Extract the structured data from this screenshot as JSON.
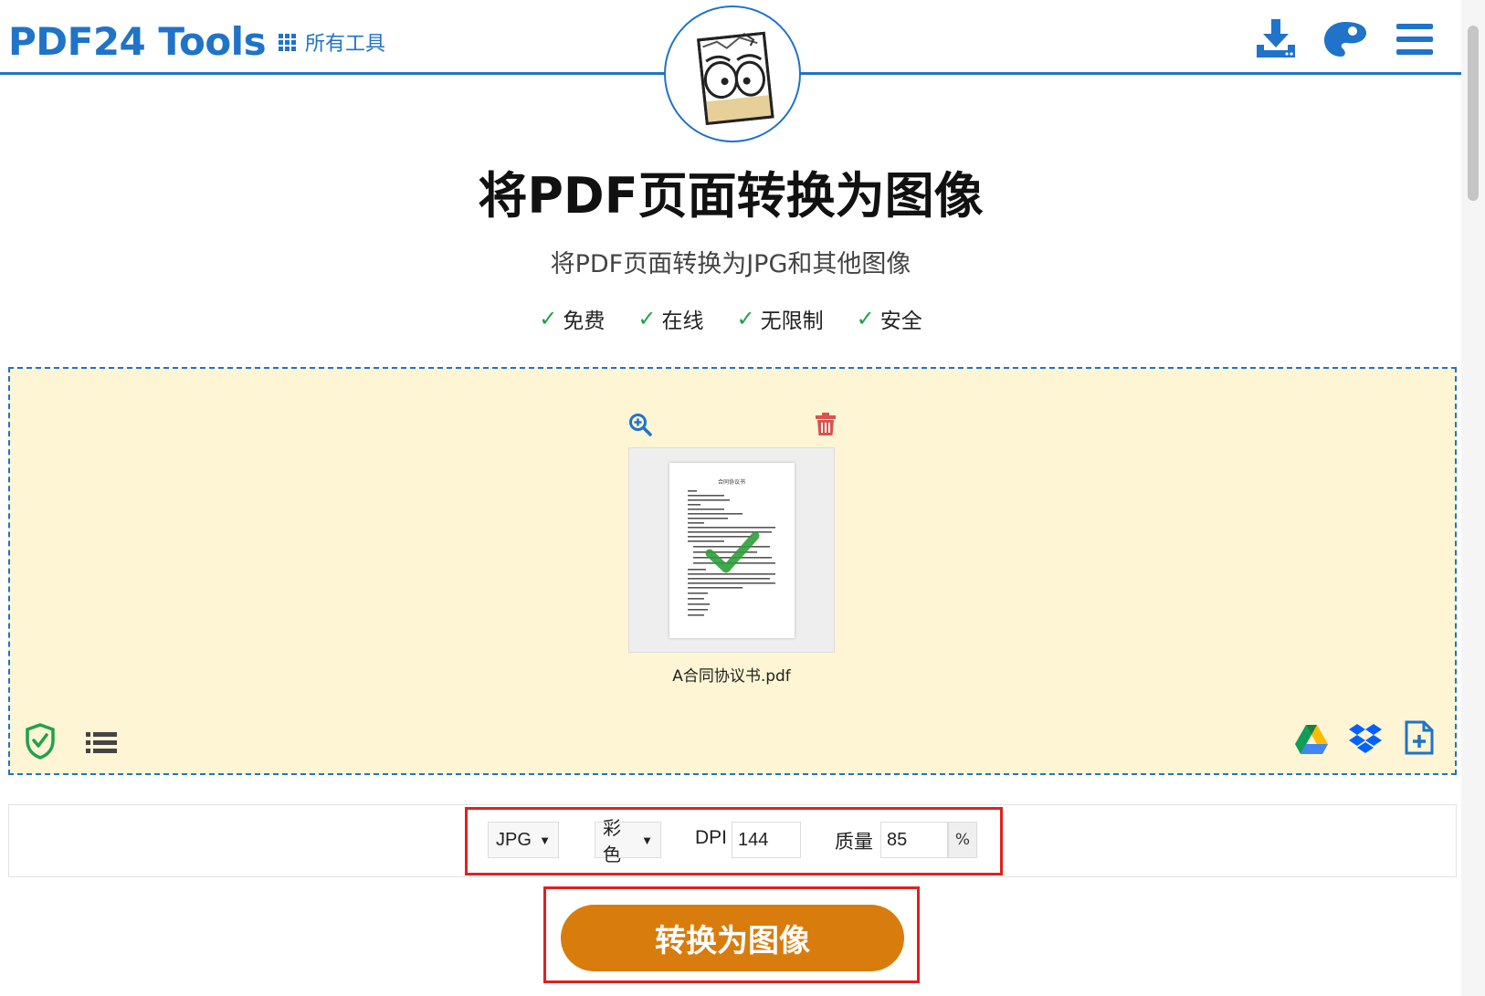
{
  "header": {
    "brand": "PDF24 Tools",
    "all_tools_label": "所有工具",
    "icons": [
      "download-icon",
      "palette-icon",
      "menu-icon"
    ]
  },
  "main": {
    "title": "将PDF页面转换为图像",
    "subtitle": "将PDF页面转换为JPG和其他图像",
    "features": [
      "免费",
      "在线",
      "无限制",
      "安全"
    ]
  },
  "dropzone": {
    "file": {
      "name": "A合同协议书.pdf",
      "preview_title": "合同协议书"
    },
    "left_icons": [
      "shield-check-icon",
      "list-view-icon"
    ],
    "right_icons": [
      "google-drive-icon",
      "dropbox-icon",
      "add-file-icon"
    ]
  },
  "options": {
    "format": "JPG",
    "color_mode": "彩色",
    "dpi_label": "DPI",
    "dpi_value": "144",
    "quality_label": "质量",
    "quality_value": "85",
    "quality_unit": "%"
  },
  "convert_button": "转换为图像",
  "colors": {
    "brand_blue": "#1f73c8",
    "dropzone_bg": "#fdf5d4",
    "convert_orange": "#d97c0e",
    "highlight_red": "#e02020",
    "check_green": "#1fa24a"
  }
}
